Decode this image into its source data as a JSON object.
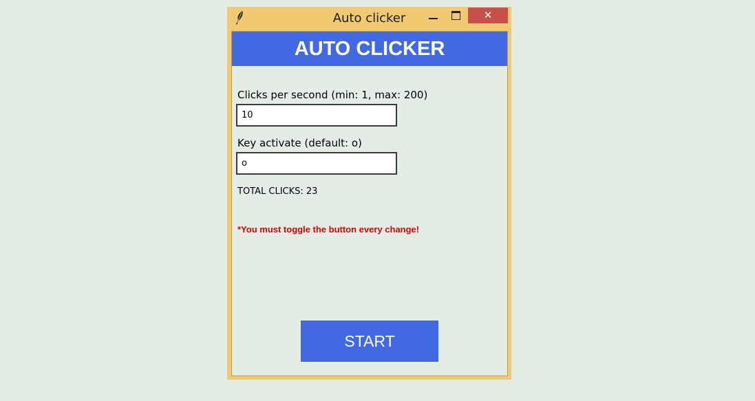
{
  "window": {
    "title": "Auto clicker",
    "close_glyph": "✕",
    "app_icon": "feather-icon"
  },
  "header": {
    "title": "AUTO CLICKER"
  },
  "form": {
    "cps_label": "Clicks per second (min: 1, max: 200)",
    "cps_value": "10",
    "key_label": "Key activate (default: o)",
    "key_value": "o"
  },
  "status": {
    "total_clicks": "TOTAL CLICKS: 23"
  },
  "note": {
    "warning": "*You must toggle the button every change!"
  },
  "actions": {
    "start_label": "START"
  },
  "colors": {
    "accent": "#4169e1",
    "window_frame": "#f1c970",
    "close_button": "#c7504a",
    "background": "#e3ede5",
    "warning_text": "#dd0000"
  }
}
